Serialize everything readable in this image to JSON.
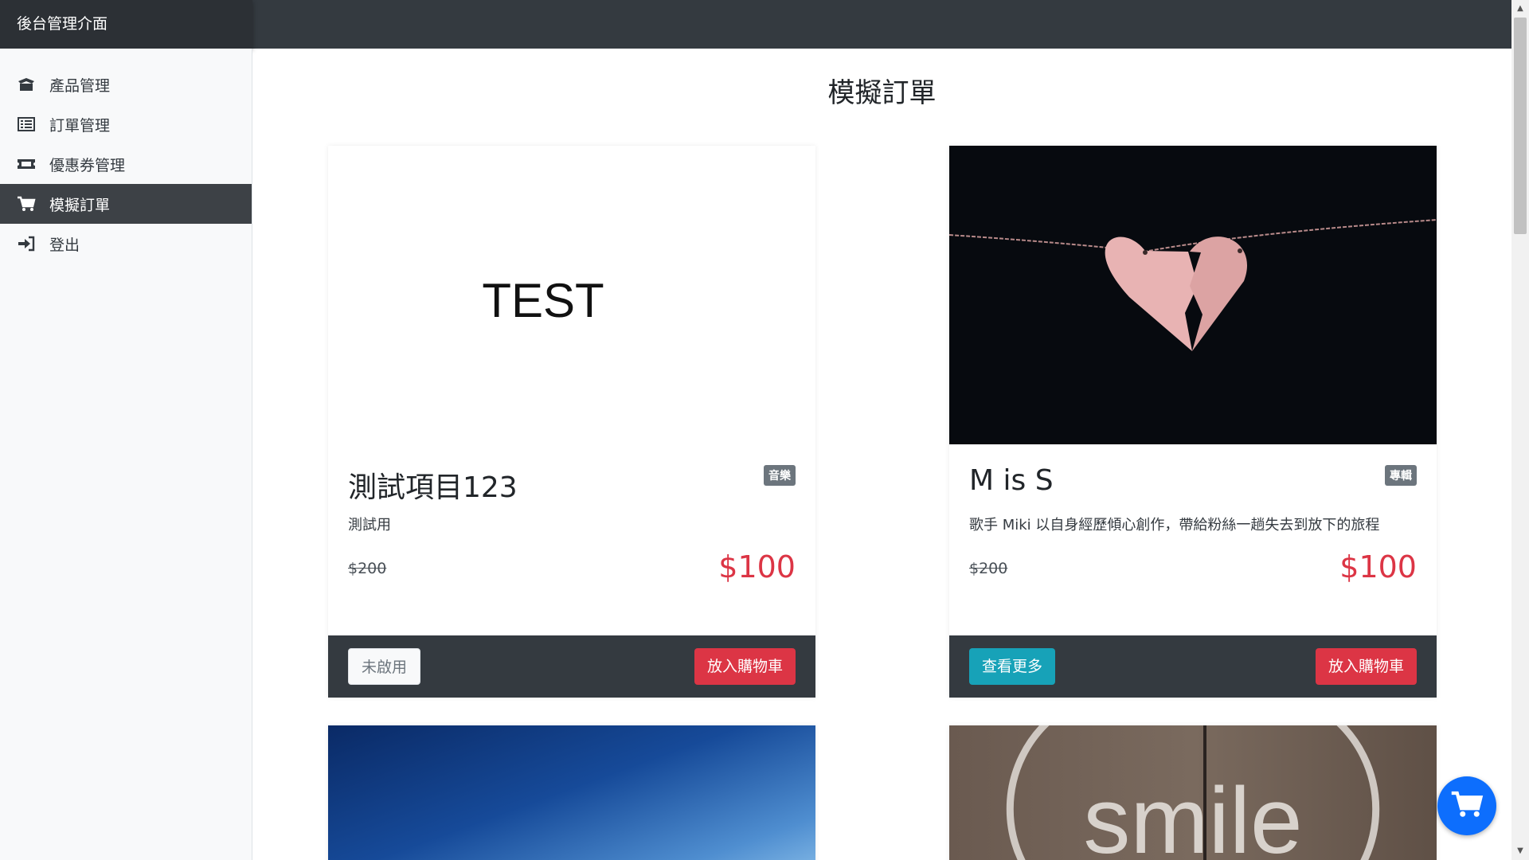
{
  "brand": {
    "title": "後台管理介面"
  },
  "sidebar": {
    "items": [
      {
        "label": "產品管理",
        "icon": "box-open-icon",
        "active": false
      },
      {
        "label": "訂單管理",
        "icon": "list-icon",
        "active": false
      },
      {
        "label": "優惠券管理",
        "icon": "ticket-icon",
        "active": false
      },
      {
        "label": "模擬訂單",
        "icon": "cart-icon",
        "active": true
      },
      {
        "label": "登出",
        "icon": "sign-in-icon",
        "active": false
      }
    ]
  },
  "main": {
    "title": "模擬訂單",
    "products": [
      {
        "name": "測試項目123",
        "category": "音樂",
        "description": "測試用",
        "origin_price": "$200",
        "price": "$100",
        "image_text": "TEST",
        "left_button": "未啟用",
        "cart_button": "放入購物車"
      },
      {
        "name": "M is S",
        "category": "專輯",
        "description": "歌手 Miki 以自身經歷傾心創作，帶給粉絲一趟失去到放下的旅程",
        "origin_price": "$200",
        "price": "$100",
        "left_button": "查看更多",
        "cart_button": "放入購物車"
      },
      {
        "image": "blue-sky"
      },
      {
        "image_text": "smile"
      }
    ]
  },
  "colors": {
    "navbar": "#343a40",
    "sidebar_bg": "#f8f9fa",
    "price": "#dc3545",
    "info_button": "#17a2b8",
    "danger_button": "#dc3545",
    "fab": "#0d6efd"
  }
}
